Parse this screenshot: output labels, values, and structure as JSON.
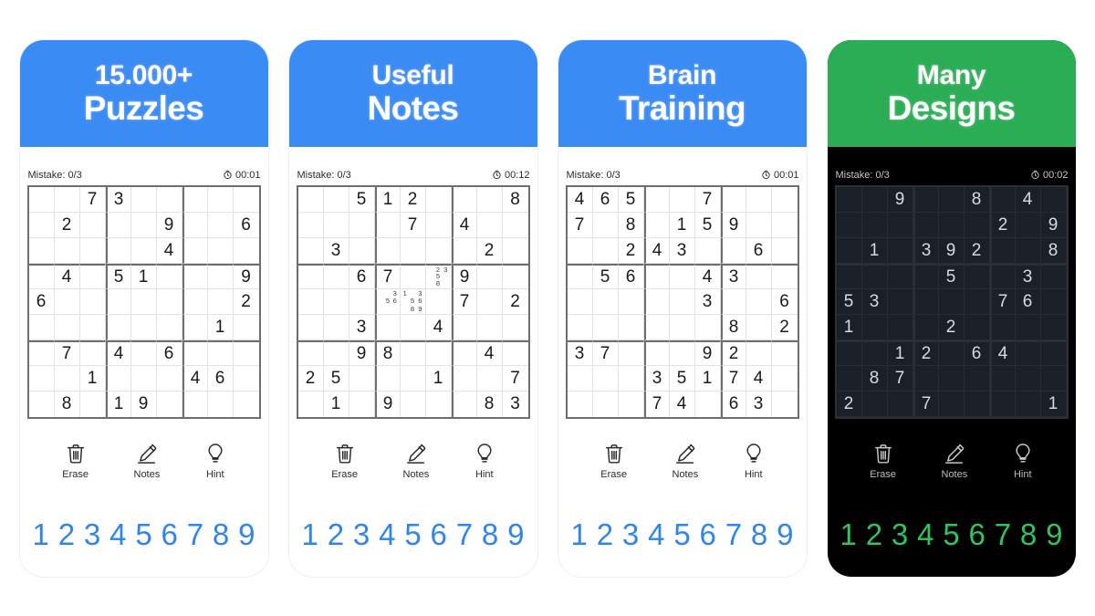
{
  "meta": {
    "background": "#ffffff",
    "accent_blue": "#3b8bf5",
    "accent_green": "#2bad56",
    "number_blue": "#2f86e8",
    "number_green": "#2fc45e"
  },
  "cards": [
    {
      "id": "card-puzzles",
      "theme": "light",
      "banner_color": "#3b8bf5",
      "title_line1": "15.000+",
      "title_line2": "Puzzles",
      "status": {
        "mistake_label": "Mistake: 0/3",
        "timer": "00:01",
        "timer_icon": "clock-icon"
      },
      "grid": [
        [
          "",
          "",
          "7",
          "3",
          "",
          "",
          "",
          "",
          ""
        ],
        [
          "",
          "2",
          "",
          "",
          "",
          "9",
          "",
          "",
          "6"
        ],
        [
          "",
          "",
          "",
          "",
          "",
          "4",
          "",
          "",
          ""
        ],
        [
          "",
          "4",
          "",
          "5",
          "1",
          "",
          "",
          "",
          "9"
        ],
        [
          "6",
          "",
          "",
          "",
          "",
          "",
          "",
          "",
          "2"
        ],
        [
          "",
          "",
          "",
          "",
          "",
          "",
          "",
          "1",
          ""
        ],
        [
          "",
          "7",
          "",
          "4",
          "",
          "6",
          "",
          "",
          ""
        ],
        [
          "",
          "",
          "1",
          "",
          "",
          "",
          "4",
          "6",
          ""
        ],
        [
          "",
          "8",
          "",
          "1",
          "9",
          "",
          "",
          "",
          ""
        ]
      ],
      "notes": {},
      "tools": [
        {
          "name": "erase-button",
          "icon": "trash-icon",
          "label": "Erase"
        },
        {
          "name": "notes-button",
          "icon": "pencil-icon",
          "label": "Notes"
        },
        {
          "name": "hint-button",
          "icon": "lightbulb-icon",
          "label": "Hint"
        }
      ],
      "numbers": [
        "1",
        "2",
        "3",
        "4",
        "5",
        "6",
        "7",
        "8",
        "9"
      ]
    },
    {
      "id": "card-notes",
      "theme": "light",
      "banner_color": "#3b8bf5",
      "title_line1": "Useful",
      "title_line2": "Notes",
      "status": {
        "mistake_label": "Mistake: 0/3",
        "timer": "00:12",
        "timer_icon": "clock-icon"
      },
      "grid": [
        [
          "",
          "",
          "5",
          "1",
          "2",
          "",
          "",
          "",
          "8"
        ],
        [
          "",
          "",
          "",
          "",
          "7",
          "",
          "4",
          "",
          ""
        ],
        [
          "",
          "3",
          "",
          "",
          "",
          "",
          "",
          "2",
          ""
        ],
        [
          "",
          "",
          "6",
          "7",
          "",
          "",
          "9",
          "",
          ""
        ],
        [
          "",
          "",
          "",
          "",
          "",
          "",
          "7",
          "",
          "2"
        ],
        [
          "",
          "",
          "3",
          "",
          "",
          "4",
          "",
          "",
          ""
        ],
        [
          "",
          "",
          "9",
          "8",
          "",
          "",
          "",
          "4",
          ""
        ],
        [
          "2",
          "5",
          "",
          "",
          "",
          "1",
          "",
          "",
          "7"
        ],
        [
          "",
          "1",
          "",
          "9",
          "",
          "",
          "",
          "8",
          "3"
        ]
      ],
      "notes": {
        "3-5": [
          "2",
          "3",
          "5",
          "8"
        ],
        "4-3": [
          "3",
          "5",
          "6"
        ],
        "4-4": [
          "1",
          "3",
          "5",
          "6",
          "8",
          "9"
        ]
      },
      "tools": [
        {
          "name": "erase-button",
          "icon": "trash-icon",
          "label": "Erase"
        },
        {
          "name": "notes-button",
          "icon": "pencil-icon",
          "label": "Notes"
        },
        {
          "name": "hint-button",
          "icon": "lightbulb-icon",
          "label": "Hint"
        }
      ],
      "numbers": [
        "1",
        "2",
        "3",
        "4",
        "5",
        "6",
        "7",
        "8",
        "9"
      ]
    },
    {
      "id": "card-brain-training",
      "theme": "light",
      "banner_color": "#3b8bf5",
      "title_line1": "Brain",
      "title_line2": "Training",
      "status": {
        "mistake_label": "Mistake: 0/3",
        "timer": "00:01",
        "timer_icon": "clock-icon"
      },
      "grid": [
        [
          "4",
          "6",
          "5",
          "",
          "",
          "7",
          "",
          "",
          ""
        ],
        [
          "7",
          "",
          "8",
          "",
          "1",
          "5",
          "9",
          "",
          ""
        ],
        [
          "",
          "",
          "2",
          "4",
          "3",
          "",
          "",
          "6",
          ""
        ],
        [
          "",
          "5",
          "6",
          "",
          "",
          "4",
          "3",
          "",
          ""
        ],
        [
          "",
          "",
          "",
          "",
          "",
          "3",
          "",
          "",
          "6"
        ],
        [
          "",
          "",
          "",
          "",
          "",
          "",
          "8",
          "",
          "2"
        ],
        [
          "3",
          "7",
          "",
          "",
          "",
          "9",
          "2",
          "",
          ""
        ],
        [
          "",
          "",
          "",
          "3",
          "5",
          "1",
          "7",
          "4",
          ""
        ],
        [
          "",
          "",
          "",
          "7",
          "4",
          "",
          "6",
          "3",
          ""
        ]
      ],
      "notes": {},
      "tools": [
        {
          "name": "erase-button",
          "icon": "trash-icon",
          "label": "Erase"
        },
        {
          "name": "notes-button",
          "icon": "pencil-icon",
          "label": "Notes"
        },
        {
          "name": "hint-button",
          "icon": "lightbulb-icon",
          "label": "Hint"
        }
      ],
      "numbers": [
        "1",
        "2",
        "3",
        "4",
        "5",
        "6",
        "7",
        "8",
        "9"
      ]
    },
    {
      "id": "card-designs",
      "theme": "dark",
      "banner_color": "#2bad56",
      "title_line1": "Many",
      "title_line2": "Designs",
      "status": {
        "mistake_label": "Mistake: 0/3",
        "timer": "00:02",
        "timer_icon": "clock-icon"
      },
      "grid": [
        [
          "",
          "",
          "9",
          "",
          "",
          "8",
          "",
          "4",
          ""
        ],
        [
          "",
          "",
          "",
          "",
          "",
          "",
          "2",
          "",
          "9"
        ],
        [
          "",
          "1",
          "",
          "3",
          "9",
          "2",
          "",
          "",
          "8"
        ],
        [
          "",
          "",
          "",
          "",
          "5",
          "",
          "",
          "3",
          ""
        ],
        [
          "5",
          "3",
          "",
          "",
          "",
          "",
          "7",
          "6",
          ""
        ],
        [
          "1",
          "",
          "",
          "",
          "2",
          "",
          "",
          "",
          ""
        ],
        [
          "",
          "",
          "1",
          "2",
          "",
          "6",
          "4",
          "",
          ""
        ],
        [
          "",
          "8",
          "7",
          "",
          "",
          "",
          "",
          "",
          ""
        ],
        [
          "2",
          "",
          "",
          "7",
          "",
          "",
          "",
          "",
          "1"
        ]
      ],
      "notes": {},
      "tools": [
        {
          "name": "erase-button",
          "icon": "trash-icon",
          "label": "Erase"
        },
        {
          "name": "notes-button",
          "icon": "pencil-icon",
          "label": "Notes"
        },
        {
          "name": "hint-button",
          "icon": "lightbulb-icon",
          "label": "Hint"
        }
      ],
      "numbers": [
        "1",
        "2",
        "3",
        "4",
        "5",
        "6",
        "7",
        "8",
        "9"
      ]
    }
  ]
}
